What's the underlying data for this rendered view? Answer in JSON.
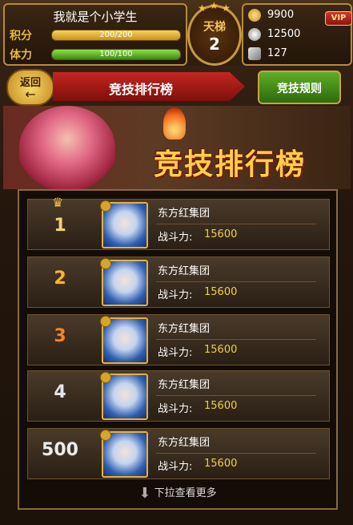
{
  "player": {
    "name": "我就是个小学生",
    "score_label": "积分",
    "score_value": "200/200",
    "score_fraction": 1.0,
    "stamina_label": "体力",
    "stamina_value": "100/100",
    "stamina_fraction": 1.0
  },
  "tier": {
    "label": "天梯",
    "value": "2"
  },
  "currency": {
    "gold": "9900",
    "silver": "12500",
    "item": "127",
    "vip_label": "VIP"
  },
  "header": {
    "back_label": "返回",
    "title": "竞技排行榜",
    "rules_label": "竞技规则"
  },
  "banner": {
    "title": "竞技排行榜"
  },
  "rankings": [
    {
      "rank": "1",
      "guild": "东方红集团",
      "power_label": "战斗力:",
      "power": "15600"
    },
    {
      "rank": "2",
      "guild": "东方红集团",
      "power_label": "战斗力:",
      "power": "15600"
    },
    {
      "rank": "3",
      "guild": "东方红集团",
      "power_label": "战斗力:",
      "power": "15600"
    },
    {
      "rank": "4",
      "guild": "东方红集团",
      "power_label": "战斗力:",
      "power": "15600"
    },
    {
      "rank": "500",
      "guild": "东方红集团",
      "power_label": "战斗力:",
      "power": "15600"
    }
  ],
  "footer": {
    "more_label": "下拉查看更多"
  },
  "colors": {
    "accent_gold": "#f0d240",
    "ribbon_red": "#c52620",
    "rules_green": "#5fae27"
  }
}
